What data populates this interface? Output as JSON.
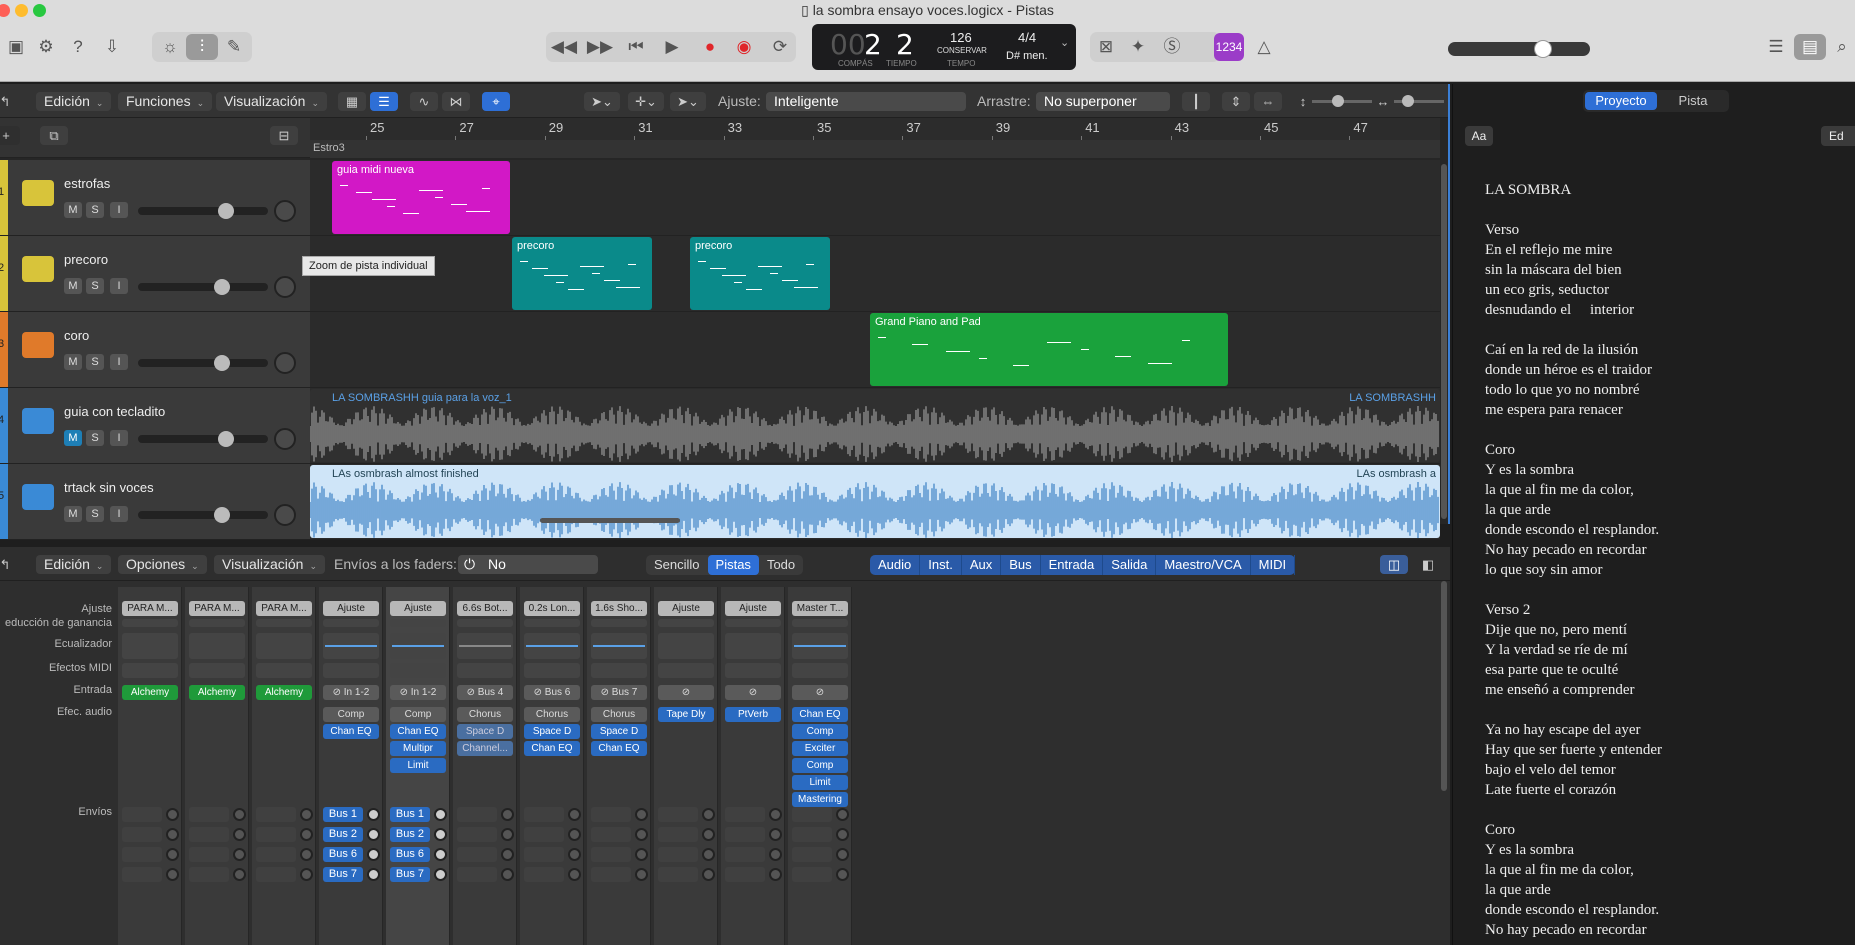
{
  "window": {
    "title": "la sombra ensayo voces.logicx - Pistas"
  },
  "lcd": {
    "bar_prefix": "00",
    "bar": "2",
    "beat": "2",
    "bar_label": "COMPÁS",
    "beat_label": "TIEMPO",
    "tempo": "126",
    "tempo_mode": "CONSERVAR",
    "tempo_label": "TEMPO",
    "signature": "4/4",
    "key": "D# men."
  },
  "countin": "1234",
  "tracks_menu": {
    "edit": "Edición",
    "functions": "Funciones",
    "view": "Visualización",
    "snap_label": "Ajuste:",
    "snap_value": "Inteligente",
    "drag_label": "Arrastre:",
    "drag_value": "No superponer"
  },
  "ruler": {
    "bars": [
      "25",
      "27",
      "29",
      "31",
      "33",
      "35",
      "37",
      "39",
      "41",
      "43",
      "45",
      "47"
    ],
    "marker": "Estro3"
  },
  "tracks": [
    {
      "number": "1",
      "name": "estrofas",
      "color": "#d8c43a",
      "solo": false
    },
    {
      "number": "2",
      "name": "precoro",
      "color": "#d8c43a",
      "solo": false
    },
    {
      "number": "3",
      "name": "coro",
      "color": "#e07a2a",
      "solo": false
    },
    {
      "number": "4",
      "name": "guia con tecladito",
      "color": "#3a8ad6",
      "solo": true
    },
    {
      "number": "5",
      "name": "trtack sin voces",
      "color": "#3a8ad6",
      "solo": false
    }
  ],
  "ms": {
    "m": "M",
    "s": "S",
    "i": "I"
  },
  "regions": {
    "estrofas": "guia midi nueva",
    "precoro1": "precoro",
    "precoro2": "precoro",
    "coro": "Grand Piano and Pad",
    "audio4": "LA SOMBRASHH guia para la voz_1",
    "audio4b": "LA SOMBRASHH",
    "audio5": "LAs osmbrash almost finished",
    "audio5b": "LAs osmbrash a"
  },
  "tooltip": "Zoom de pista individual",
  "mixer_menu": {
    "edit": "Edición",
    "options": "Opciones",
    "view": "Visualización",
    "sends_label": "Envíos a los faders:",
    "sends_value": "No",
    "simple": "Sencillo",
    "tracks": "Pistas",
    "all": "Todo"
  },
  "mixer_filters": [
    "Audio",
    "Inst.",
    "Aux",
    "Bus",
    "Entrada",
    "Salida",
    "Maestro/VCA",
    "MIDI"
  ],
  "mixer_rows": {
    "setting": "Ajuste",
    "gain": "educción de ganancia",
    "eq": "Ecualizador",
    "midi_fx": "Efectos MIDI",
    "input": "Entrada",
    "audio_fx": "Efec. audio",
    "sends": "Envíos"
  },
  "strips": [
    {
      "setting": "PARA M...",
      "input": "Alchemy",
      "fx": [],
      "sends": []
    },
    {
      "setting": "PARA M...",
      "input": "Alchemy",
      "fx": [],
      "sends": []
    },
    {
      "setting": "PARA M...",
      "input": "Alchemy",
      "fx": [],
      "sends": []
    },
    {
      "setting": "Ajuste",
      "input": "In 1-2",
      "fx": [
        "Comp",
        "Chan EQ"
      ],
      "sends": [
        "Bus 1",
        "Bus 2",
        "Bus 6",
        "Bus 7"
      ]
    },
    {
      "setting": "Ajuste",
      "input": "In 1-2",
      "fx": [
        "Comp",
        "Chan EQ",
        "Multipr",
        "Limit"
      ],
      "sends": [
        "Bus 1",
        "Bus 2",
        "Bus 6",
        "Bus 7"
      ]
    },
    {
      "setting": "6.6s Bot...",
      "input": "Bus 4",
      "fx": [
        "Chorus",
        "Space D",
        "Channel..."
      ],
      "sends": []
    },
    {
      "setting": "0.2s Lon...",
      "input": "Bus 6",
      "fx": [
        "Chorus",
        "Space D",
        "Chan EQ"
      ],
      "sends": []
    },
    {
      "setting": "1.6s Sho...",
      "input": "Bus 7",
      "fx": [
        "Chorus",
        "Space D",
        "Chan EQ"
      ],
      "sends": []
    },
    {
      "setting": "Ajuste",
      "input": "",
      "fx": [
        "Tape Dly"
      ],
      "sends": []
    },
    {
      "setting": "Ajuste",
      "input": "",
      "fx": [
        "PtVerb"
      ],
      "sends": []
    },
    {
      "setting": "Master T...",
      "input": "",
      "fx": [
        "Chan EQ",
        "Comp",
        "Exciter",
        "Comp",
        "Limit",
        "Mastering"
      ],
      "sends": []
    }
  ],
  "panel": {
    "tab_project": "Proyecto",
    "tab_track": "Pista",
    "font_btn": "Aa",
    "edit_btn": "Ed"
  },
  "lyrics": "LA SOMBRA\n\nVerso\nEn el reflejo me mire\nsin la máscara del bien\nun eco gris, seductor\ndesnudando el     interior\n\nCaí en la red de la ilusión\ndonde un héroe es el traidor\ntodo lo que yo no nombré\nme espera para renacer\n\nCoro\nY es la sombra\nla que al fin me da color,\nla que arde\ndonde escondo el resplandor.\nNo hay pecado en recordar\nlo que soy sin amor\n\nVerso 2\nDije que no, pero mentí\nY la verdad se ríe de mí\nesa parte que te oculté\nme enseñó a comprender\n\nYa no hay escape del ayer\nHay que ser fuerte y entender\nbajo el velo del temor\nLate fuerte el corazón\n\nCoro\nY es la sombra\nla que al fin me da color,\nla que arde\ndonde escondo el resplandor.\nNo hay pecado en recordar"
}
